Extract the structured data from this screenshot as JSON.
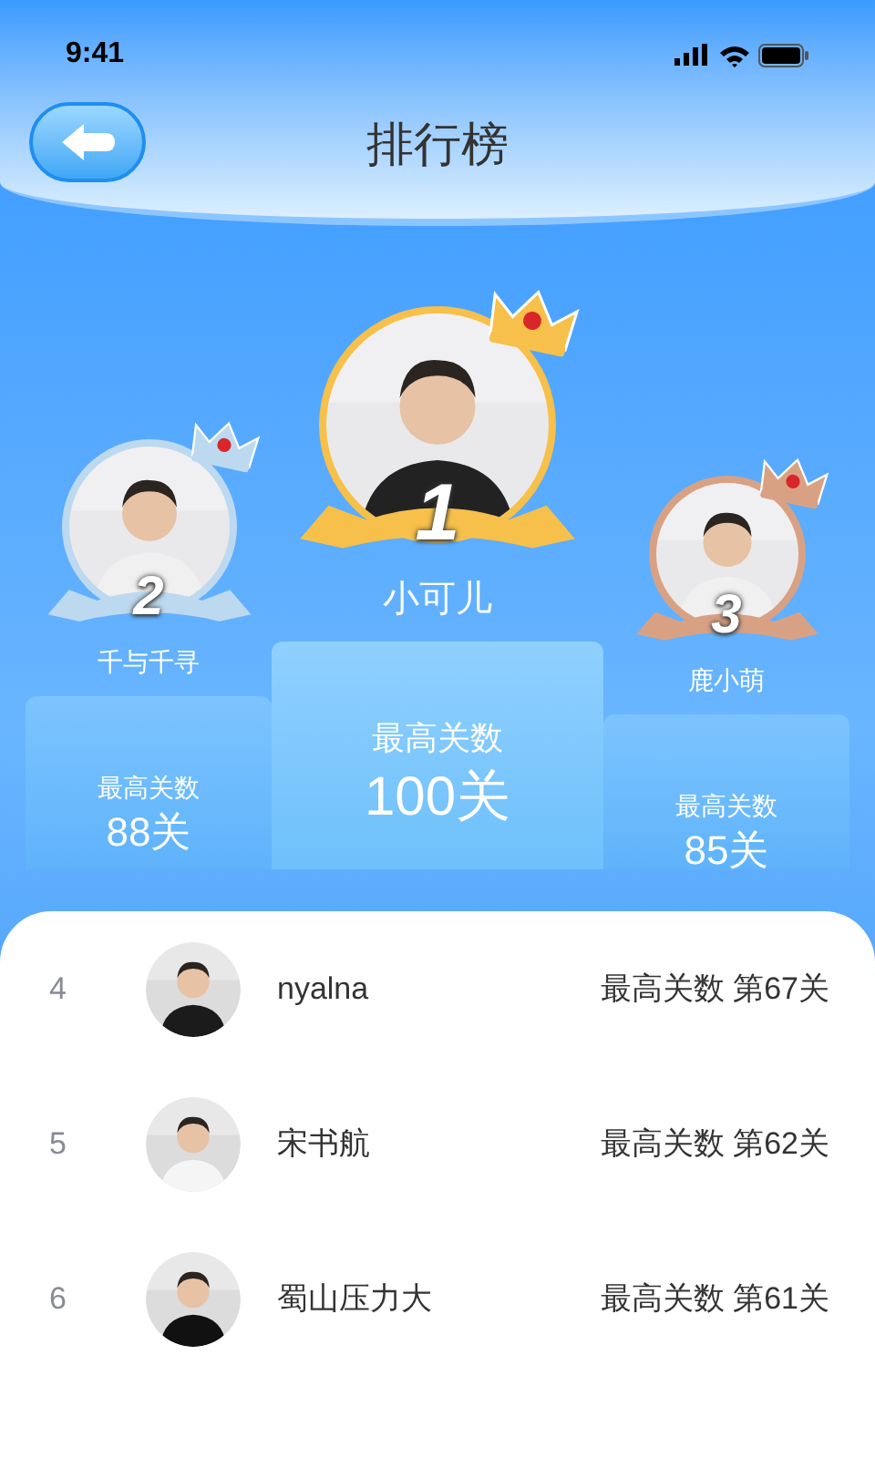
{
  "status_bar": {
    "time": "9:41"
  },
  "header": {
    "title": "排行榜"
  },
  "podium": [
    {
      "rank": "2",
      "name": "千与千寻",
      "label": "最高关数",
      "score": "88关",
      "color": "#bcd9f0",
      "kind": "second"
    },
    {
      "rank": "1",
      "name": "小可儿",
      "label": "最高关数",
      "score": "100关",
      "color": "#f6c04a",
      "kind": "first"
    },
    {
      "rank": "3",
      "name": "鹿小萌",
      "label": "最高关数",
      "score": "85关",
      "color": "#d9a184",
      "kind": "third"
    }
  ],
  "list": [
    {
      "rank": "4",
      "name": "nyalna",
      "score": "最高关数 第67关"
    },
    {
      "rank": "5",
      "name": "宋书航",
      "score": "最高关数 第62关"
    },
    {
      "rank": "6",
      "name": "蜀山压力大",
      "score": "最高关数 第61关"
    }
  ]
}
